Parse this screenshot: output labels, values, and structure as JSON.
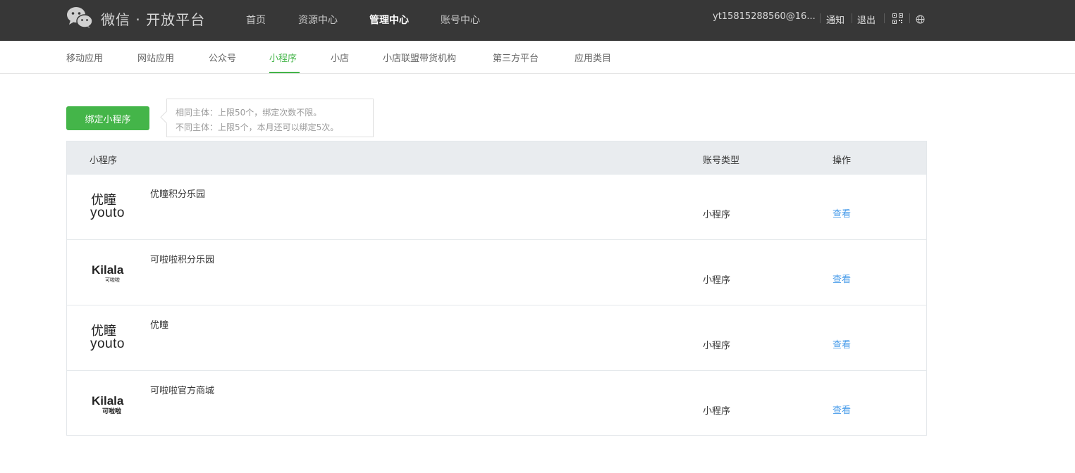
{
  "header": {
    "brand": "微信 · 开放平台",
    "nav": [
      "首页",
      "资源中心",
      "管理中心",
      "账号中心"
    ],
    "active_nav": "管理中心",
    "user_email": "yt15815288560@16...",
    "notify_label": "通知",
    "logout_label": "退出",
    "qrcode_icon": "qrcode-icon",
    "globe_icon": "globe-icon"
  },
  "subnav": {
    "items": [
      "移动应用",
      "网站应用",
      "公众号",
      "小程序",
      "小店",
      "小店联盟带货机构",
      "第三方平台",
      "应用类目"
    ],
    "active": "小程序"
  },
  "bind": {
    "button_label": "绑定小程序",
    "tip_line1": "相同主体：上限50个，绑定次数不限。",
    "tip_line2": "不同主体：上限5个，本月还可以绑定5次。"
  },
  "table": {
    "columns": [
      "小程序",
      "账号类型",
      "操作"
    ],
    "rows": [
      {
        "name": "优瞳积分乐园",
        "type": "小程序",
        "action": "查看",
        "logo": {
          "top": "优瞳",
          "bottom": "youto"
        }
      },
      {
        "name": "可啦啦积分乐园",
        "type": "小程序",
        "action": "查看",
        "logo": {
          "top": "Kilala",
          "bottom": "可啦啦"
        }
      },
      {
        "name": "优瞳",
        "type": "小程序",
        "action": "查看",
        "logo": {
          "top": "优瞳",
          "bottom": "youto"
        }
      },
      {
        "name": "可啦啦官方商城",
        "type": "小程序",
        "action": "查看",
        "logo": {
          "top": "Kilala",
          "bottom": "可啦啦"
        }
      }
    ]
  },
  "colors": {
    "topbar": "#373737",
    "accent_green": "#44b549",
    "link_blue": "#459ae9",
    "table_header": "#e9ecef"
  }
}
